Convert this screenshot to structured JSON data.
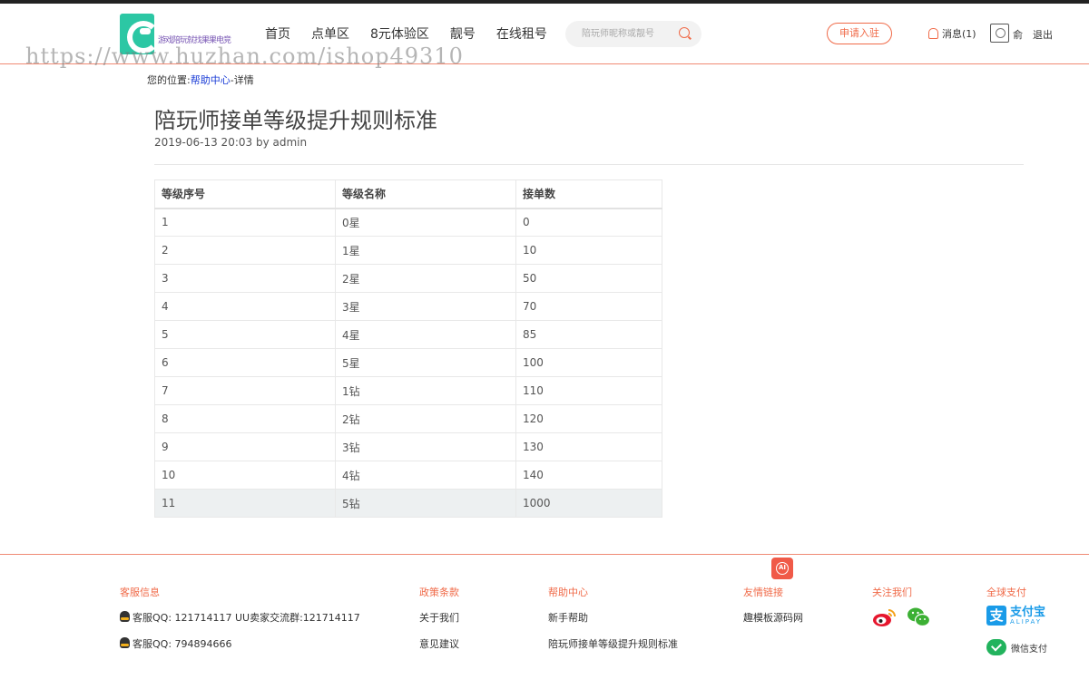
{
  "header": {
    "logo_text": "游戏陪玩就找果果电竞",
    "nav": [
      "首页",
      "点单区",
      "8元体验区",
      "靓号",
      "在线租号"
    ],
    "search_placeholder": "陪玩师昵称或靓号",
    "apply_label": "申请入驻",
    "messages_label": "消息(1)",
    "username": "俞",
    "logout_label": "退出"
  },
  "watermark": "https://www.huzhan.com/ishop49310",
  "breadcrumb": {
    "prefix": "您的位置:",
    "link": "帮助中心",
    "suffix": "-详情"
  },
  "article": {
    "title": "陪玩师接单等级提升规则标准",
    "meta": "2019-06-13 20:03 by admin"
  },
  "table": {
    "headers": [
      "等级序号",
      "等级名称",
      "接单数"
    ],
    "rows": [
      [
        "1",
        "0星",
        "0"
      ],
      [
        "2",
        "1星",
        "10"
      ],
      [
        "3",
        "2星",
        "50"
      ],
      [
        "4",
        "3星",
        "70"
      ],
      [
        "5",
        "4星",
        "85"
      ],
      [
        "6",
        "5星",
        "100"
      ],
      [
        "7",
        "1钻",
        "110"
      ],
      [
        "8",
        "2钻",
        "120"
      ],
      [
        "9",
        "3钻",
        "130"
      ],
      [
        "10",
        "4钻",
        "140"
      ],
      [
        "11",
        "5钻",
        "1000"
      ]
    ]
  },
  "footer": {
    "service": {
      "heading": "客服信息",
      "items": [
        "客服QQ: 121714117 UU卖家交流群:121714117",
        "客服QQ: 794894666"
      ]
    },
    "policy": {
      "heading": "政策条款",
      "items": [
        "关于我们",
        "意见建议"
      ]
    },
    "help": {
      "heading": "帮助中心",
      "items": [
        "新手帮助",
        "陪玩师接单等级提升规则标准"
      ]
    },
    "links": {
      "heading": "友情链接",
      "items": [
        "趣模板源码网"
      ]
    },
    "follow": {
      "heading": "关注我们",
      "icons": [
        "weibo-icon",
        "wechat-icon"
      ]
    },
    "payment": {
      "heading": "全球支付",
      "alipay_cn": "支付宝",
      "alipay_en": "ALIPAY",
      "wechat_pay": "微信支付"
    },
    "ai_badge": "AI"
  },
  "colors": {
    "accent": "#f06a48",
    "link": "#1a3cd6",
    "alipay": "#1a9be8",
    "wechat": "#22b35d",
    "logo": "#2cc7a4"
  }
}
